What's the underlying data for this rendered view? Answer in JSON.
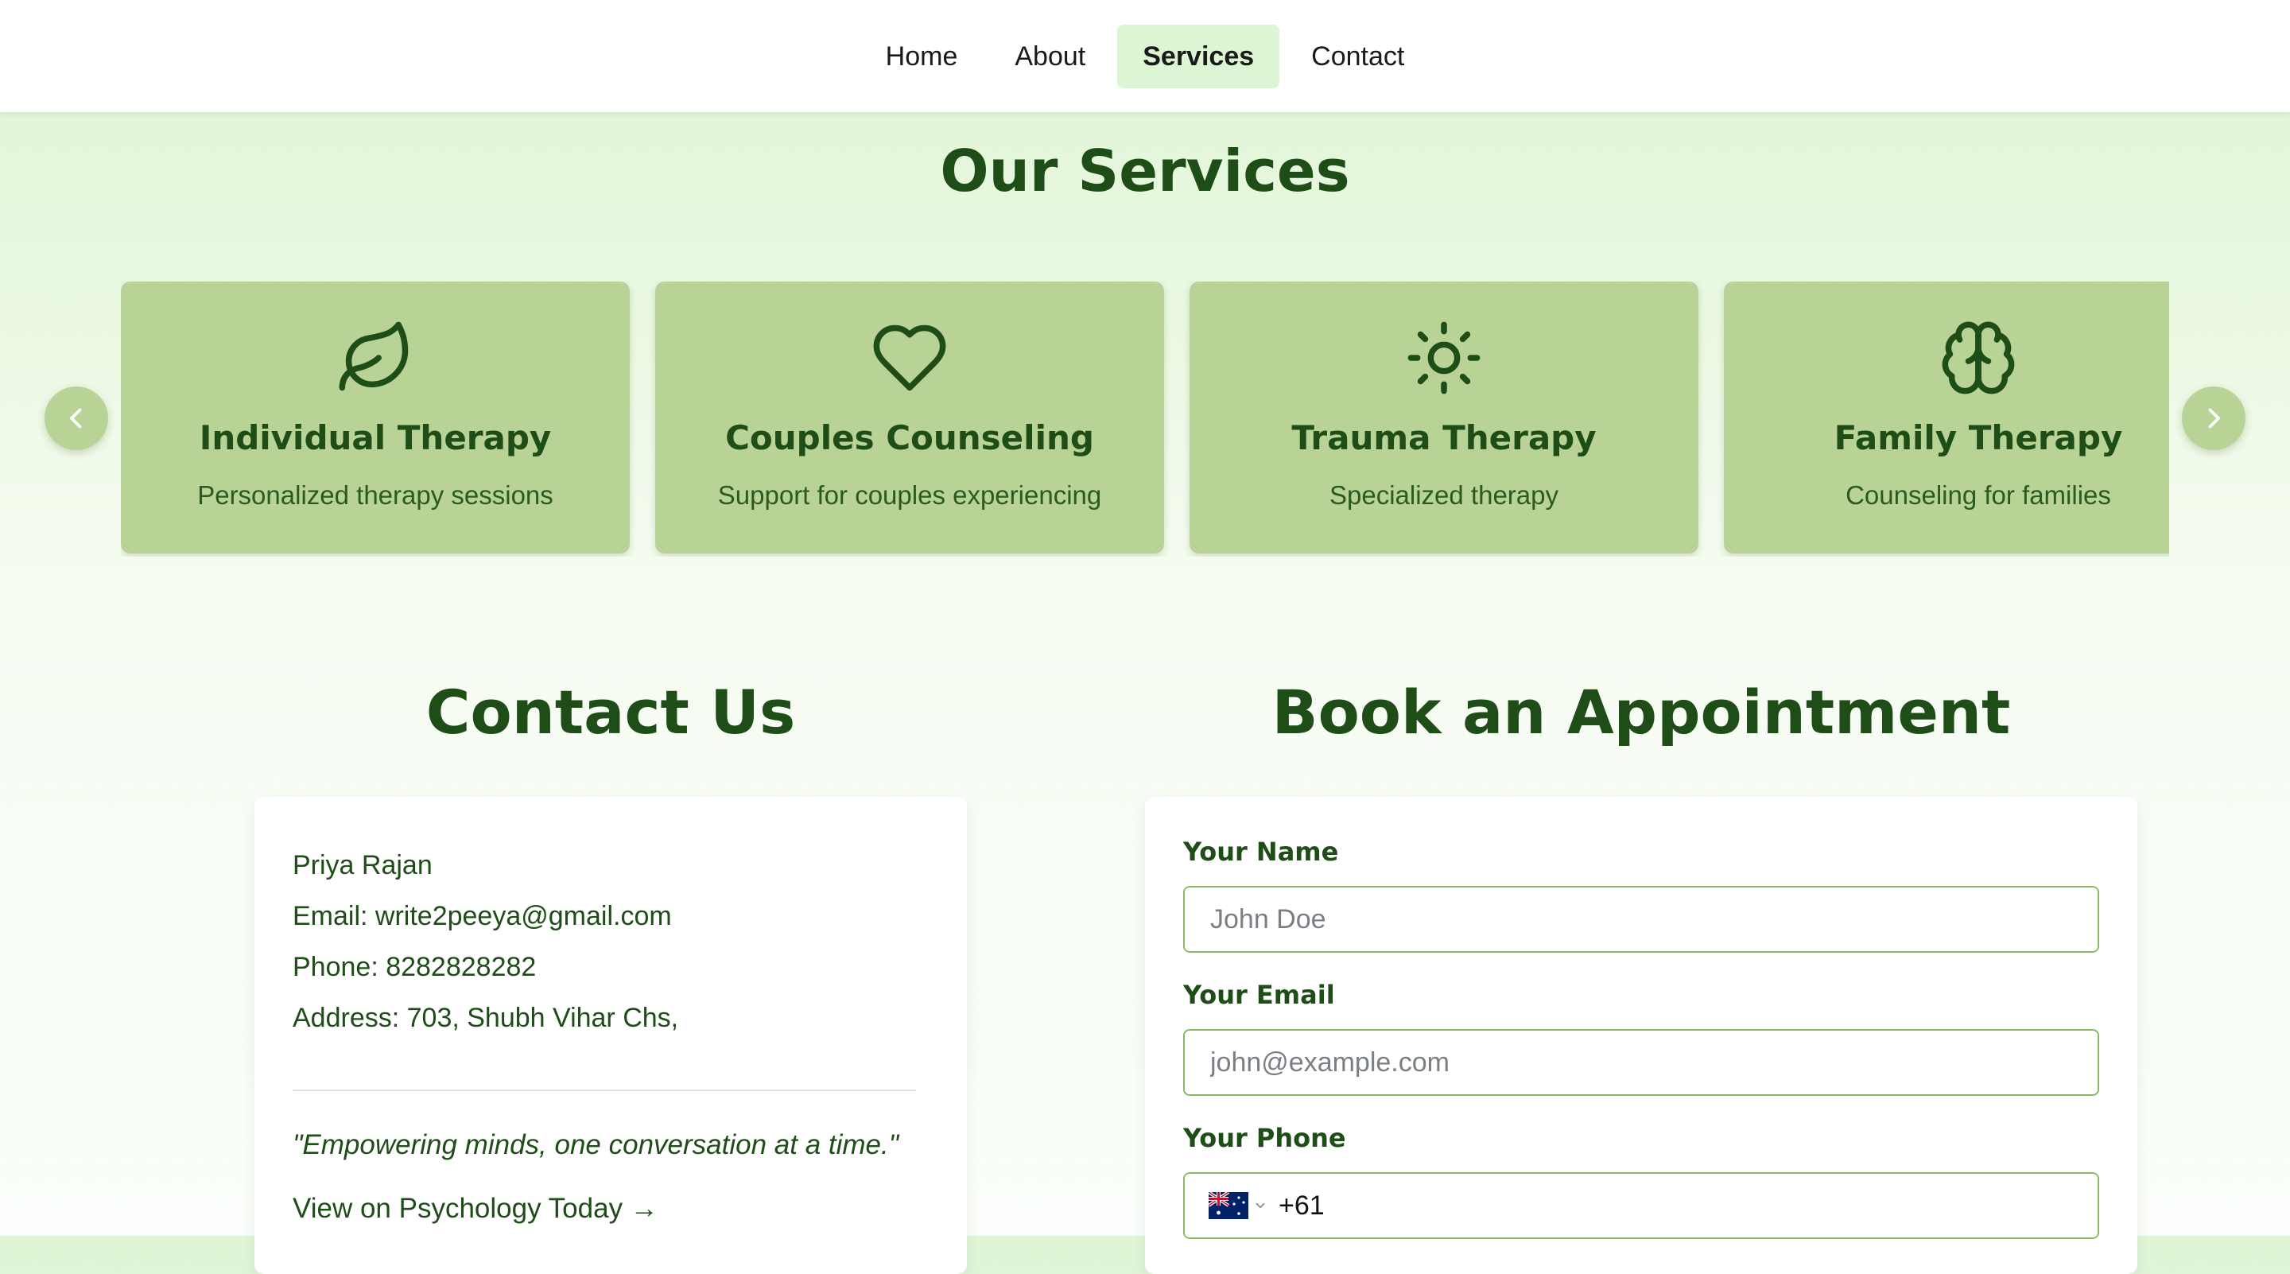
{
  "nav": {
    "items": [
      {
        "label": "Home",
        "active": false
      },
      {
        "label": "About",
        "active": false
      },
      {
        "label": "Services",
        "active": true
      },
      {
        "label": "Contact",
        "active": false
      }
    ]
  },
  "services": {
    "title": "Our Services",
    "cards": [
      {
        "icon": "leaf-icon",
        "title": "Individual Therapy",
        "description": "Personalized therapy sessions"
      },
      {
        "icon": "heart-icon",
        "title": "Couples Counseling",
        "description": "Support for couples experiencing"
      },
      {
        "icon": "sun-icon",
        "title": "Trauma Therapy",
        "description": "Specialized therapy"
      },
      {
        "icon": "brain-icon",
        "title": "Family Therapy",
        "description": "Counseling for families"
      }
    ]
  },
  "contact": {
    "title": "Contact Us",
    "name": "Priya Rajan",
    "email": "Email: write2peeya@gmail.com",
    "phone": "Phone: 8282828282",
    "address": "Address: 703, Shubh Vihar Chs,",
    "quote": "\"Empowering minds, one conversation at a time.\"",
    "link": "View on Psychology Today →"
  },
  "booking": {
    "title": "Book an Appointment",
    "name_label": "Your Name",
    "name_placeholder": "John Doe",
    "email_label": "Your Email",
    "email_placeholder": "john@example.com",
    "phone_label": "Your Phone",
    "phone_country": "australia-flag-icon",
    "phone_code": "+61"
  },
  "colors": {
    "primary": "#1e4d18",
    "card_bg": "#b9d396",
    "nav_active_bg": "#dcf5d2",
    "input_border": "#8ab86a"
  }
}
